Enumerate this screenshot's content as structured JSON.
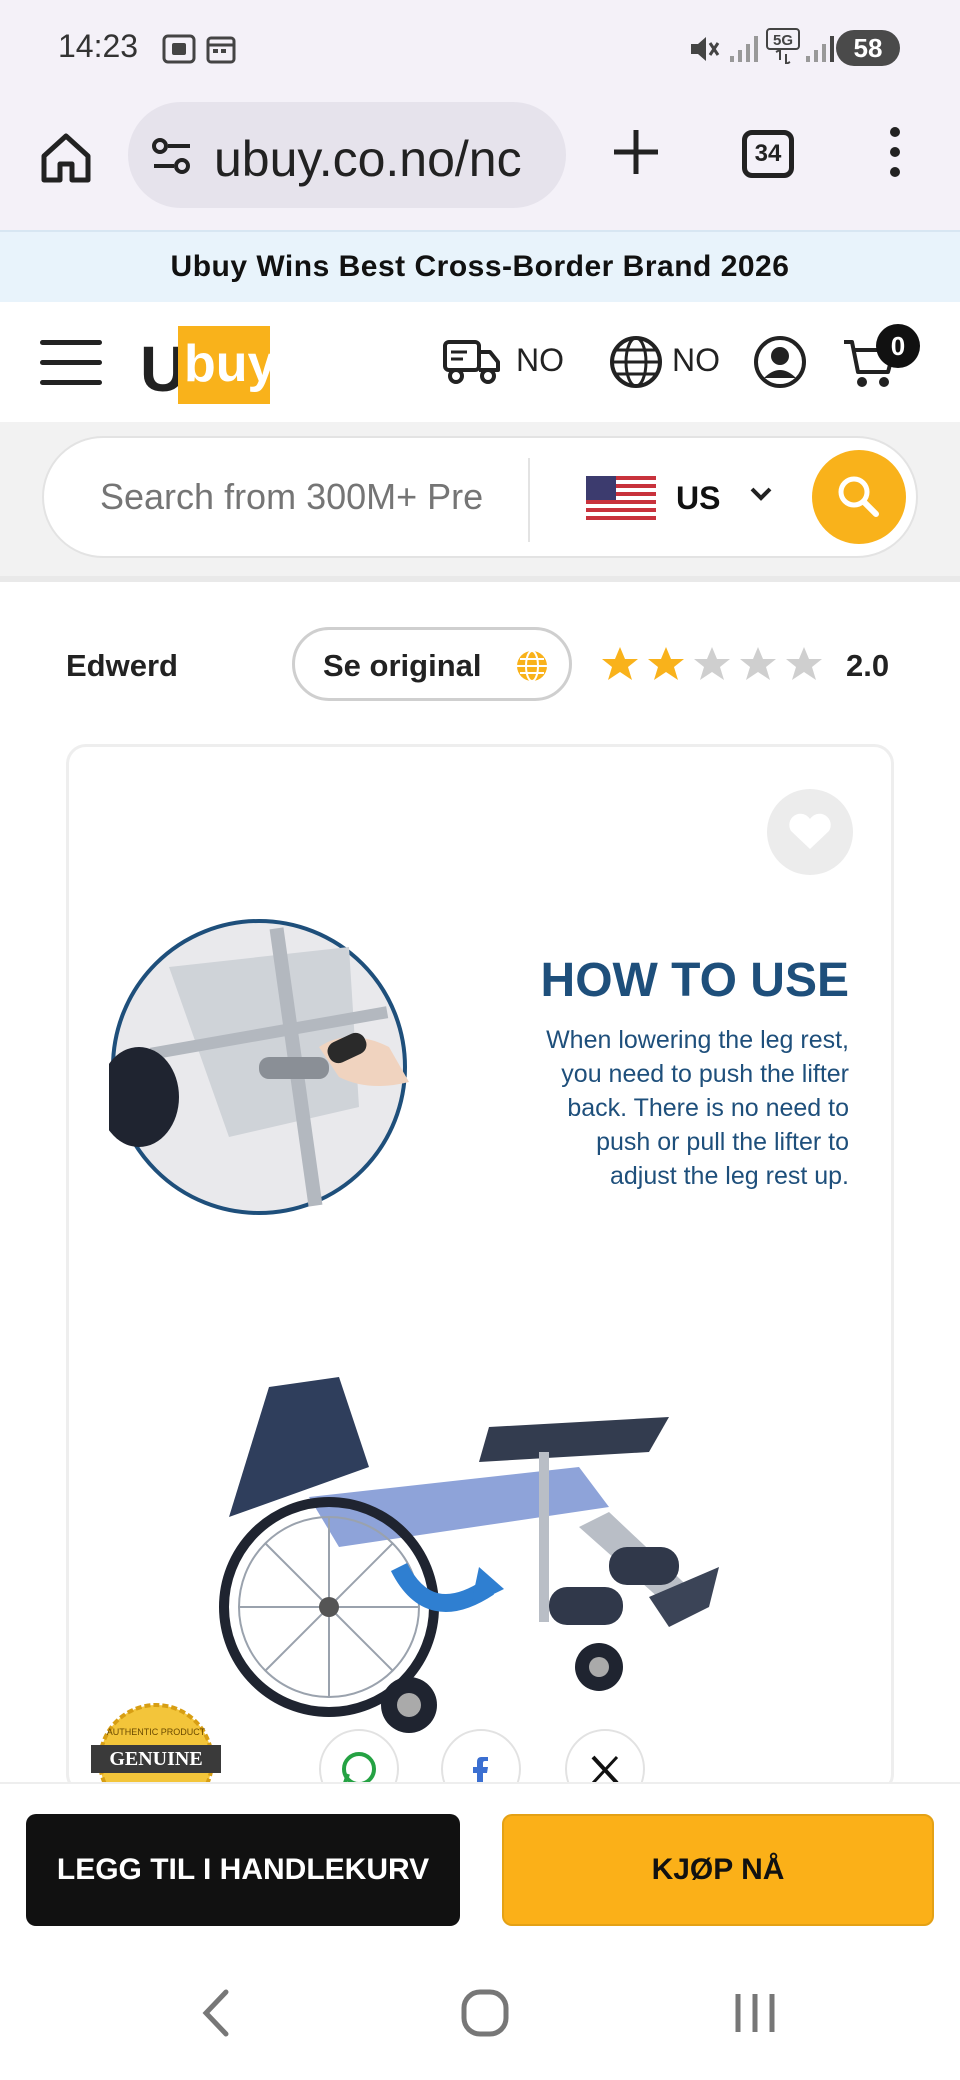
{
  "status_bar": {
    "time": "14:23",
    "battery": "58",
    "icons": [
      "screenshot-icon",
      "calendar-icon",
      "mute-icon",
      "signal-icon",
      "5g-icon",
      "signal-icon",
      "battery-icon"
    ]
  },
  "browser": {
    "url": "ubuy.co.no/nc",
    "tab_count": "34",
    "icons": [
      "home-icon",
      "tune-icon",
      "plus-icon",
      "tabs-icon",
      "more-vert-icon"
    ]
  },
  "promo_banner": {
    "text": "Ubuy Wins Best Cross-Border Brand 2026"
  },
  "site_header": {
    "logo_u": "U",
    "logo_buy": "buy",
    "shipping_country": "NO",
    "language": "NO",
    "cart_count": "0",
    "icons": [
      "menu-icon",
      "truck-icon",
      "globe-icon",
      "account-icon",
      "cart-icon"
    ]
  },
  "search": {
    "placeholder": "Search from 300M+ Pre",
    "store_country": "US",
    "icons": [
      "us-flag-icon",
      "chevron-down-icon",
      "search-icon"
    ]
  },
  "review": {
    "reviewer": "Edwerd",
    "see_original_label": "Se original",
    "rating": "2.0",
    "rating_value": 2,
    "rating_max": 5
  },
  "product_card": {
    "howto_title": "HOW TO USE",
    "howto_lines": [
      "When lowering the leg rest,",
      "you need to push the lifter",
      "back. There is no need to",
      "push or pull the lifter to",
      "adjust the leg rest up."
    ],
    "badge_top": "AUTHENTIC PRODUCT",
    "badge_main": "GENUINE",
    "share": [
      "whatsapp-icon",
      "facebook-icon",
      "x-icon"
    ]
  },
  "actions": {
    "add_to_cart": "LEGG TIL I HANDLEKURV",
    "buy_now": "KJØP NÅ"
  },
  "colors": {
    "brand_yellow": "#f9b21b",
    "howto_blue": "#1e4f7b",
    "promo_bg": "#e8f3fb",
    "star_filled": "#f9b21b",
    "star_empty": "#cfcfcf"
  }
}
